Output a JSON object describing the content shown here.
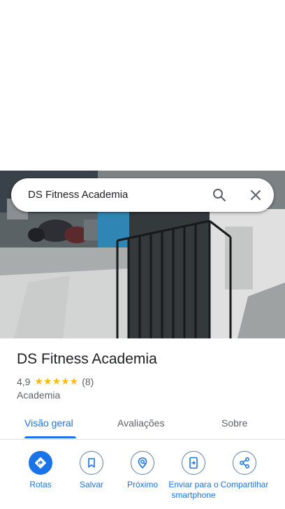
{
  "search": {
    "query": "DS Fitness Academia"
  },
  "place": {
    "name": "DS Fitness Academia",
    "rating": "4,9",
    "stars": "★★★★★",
    "reviews": "(8)",
    "category": "Academia"
  },
  "tabs": [
    {
      "label": "Visão geral",
      "active": true
    },
    {
      "label": "Avaliações"
    },
    {
      "label": "Sobre"
    }
  ],
  "actions": [
    {
      "label": "Rotas",
      "icon": "directions-icon"
    },
    {
      "label": "Salvar",
      "icon": "bookmark-icon"
    },
    {
      "label": "Próximo",
      "icon": "nearby-icon"
    },
    {
      "label": "Enviar para o smartphone",
      "icon": "send-to-phone-icon"
    },
    {
      "label": "Compartilhar",
      "icon": "share-icon"
    }
  ],
  "colors": {
    "accent": "#1a73e8",
    "star": "#fbbc04",
    "text": "#202124",
    "secondary": "#5f6368"
  }
}
